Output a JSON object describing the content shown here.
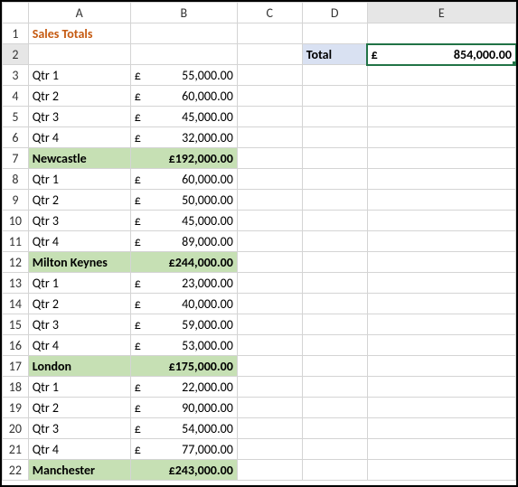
{
  "chart_data": {
    "type": "table",
    "title": "Sales Totals",
    "currency": "£",
    "groups": [
      {
        "name": "Newcastle",
        "subtotal": 192000,
        "rows": [
          {
            "label": "Qtr 1",
            "value": 55000
          },
          {
            "label": "Qtr 2",
            "value": 60000
          },
          {
            "label": "Qtr 3",
            "value": 45000
          },
          {
            "label": "Qtr 4",
            "value": 32000
          }
        ]
      },
      {
        "name": "Milton Keynes",
        "subtotal": 244000,
        "rows": [
          {
            "label": "Qtr 1",
            "value": 60000
          },
          {
            "label": "Qtr 2",
            "value": 50000
          },
          {
            "label": "Qtr 3",
            "value": 45000
          },
          {
            "label": "Qtr 4",
            "value": 89000
          }
        ]
      },
      {
        "name": "London",
        "subtotal": 175000,
        "rows": [
          {
            "label": "Qtr 1",
            "value": 23000
          },
          {
            "label": "Qtr 2",
            "value": 40000
          },
          {
            "label": "Qtr 3",
            "value": 59000
          },
          {
            "label": "Qtr 4",
            "value": 53000
          }
        ]
      },
      {
        "name": "Manchester",
        "subtotal": 243000,
        "rows": [
          {
            "label": "Qtr 1",
            "value": 22000
          },
          {
            "label": "Qtr 2",
            "value": 90000
          },
          {
            "label": "Qtr 3",
            "value": 54000
          },
          {
            "label": "Qtr 4",
            "value": 77000
          }
        ]
      }
    ],
    "grand_total": {
      "label": "Total",
      "value": 854000
    }
  },
  "headers": {
    "cols": [
      "A",
      "B",
      "C",
      "D",
      "E"
    ],
    "rows": [
      "1",
      "2",
      "3",
      "4",
      "5",
      "6",
      "7",
      "8",
      "9",
      "10",
      "11",
      "12",
      "13",
      "14",
      "15",
      "16",
      "17",
      "18",
      "19",
      "20",
      "21",
      "22"
    ]
  },
  "title": "Sales Totals",
  "total_label": "Total",
  "currency_symbol": "£",
  "cells": {
    "r3": {
      "a": "Qtr 1",
      "b": "55,000.00"
    },
    "r4": {
      "a": "Qtr 2",
      "b": "60,000.00"
    },
    "r5": {
      "a": "Qtr 3",
      "b": "45,000.00"
    },
    "r6": {
      "a": "Qtr 4",
      "b": "32,000.00"
    },
    "r7": {
      "a": "Newcastle",
      "b": "£192,000.00"
    },
    "r8": {
      "a": "Qtr 1",
      "b": "60,000.00"
    },
    "r9": {
      "a": "Qtr 2",
      "b": "50,000.00"
    },
    "r10": {
      "a": "Qtr 3",
      "b": "45,000.00"
    },
    "r11": {
      "a": "Qtr 4",
      "b": "89,000.00"
    },
    "r12": {
      "a": "Milton Keynes",
      "b": "£244,000.00"
    },
    "r13": {
      "a": "Qtr 1",
      "b": "23,000.00"
    },
    "r14": {
      "a": "Qtr 2",
      "b": "40,000.00"
    },
    "r15": {
      "a": "Qtr 3",
      "b": "59,000.00"
    },
    "r16": {
      "a": "Qtr 4",
      "b": "53,000.00"
    },
    "r17": {
      "a": "London",
      "b": "£175,000.00"
    },
    "r18": {
      "a": "Qtr 1",
      "b": "22,000.00"
    },
    "r19": {
      "a": "Qtr 2",
      "b": "90,000.00"
    },
    "r20": {
      "a": "Qtr 3",
      "b": "54,000.00"
    },
    "r21": {
      "a": "Qtr 4",
      "b": "77,000.00"
    },
    "r22": {
      "a": "Manchester",
      "b": "£243,000.00"
    }
  },
  "grand_total_value": "854,000.00"
}
